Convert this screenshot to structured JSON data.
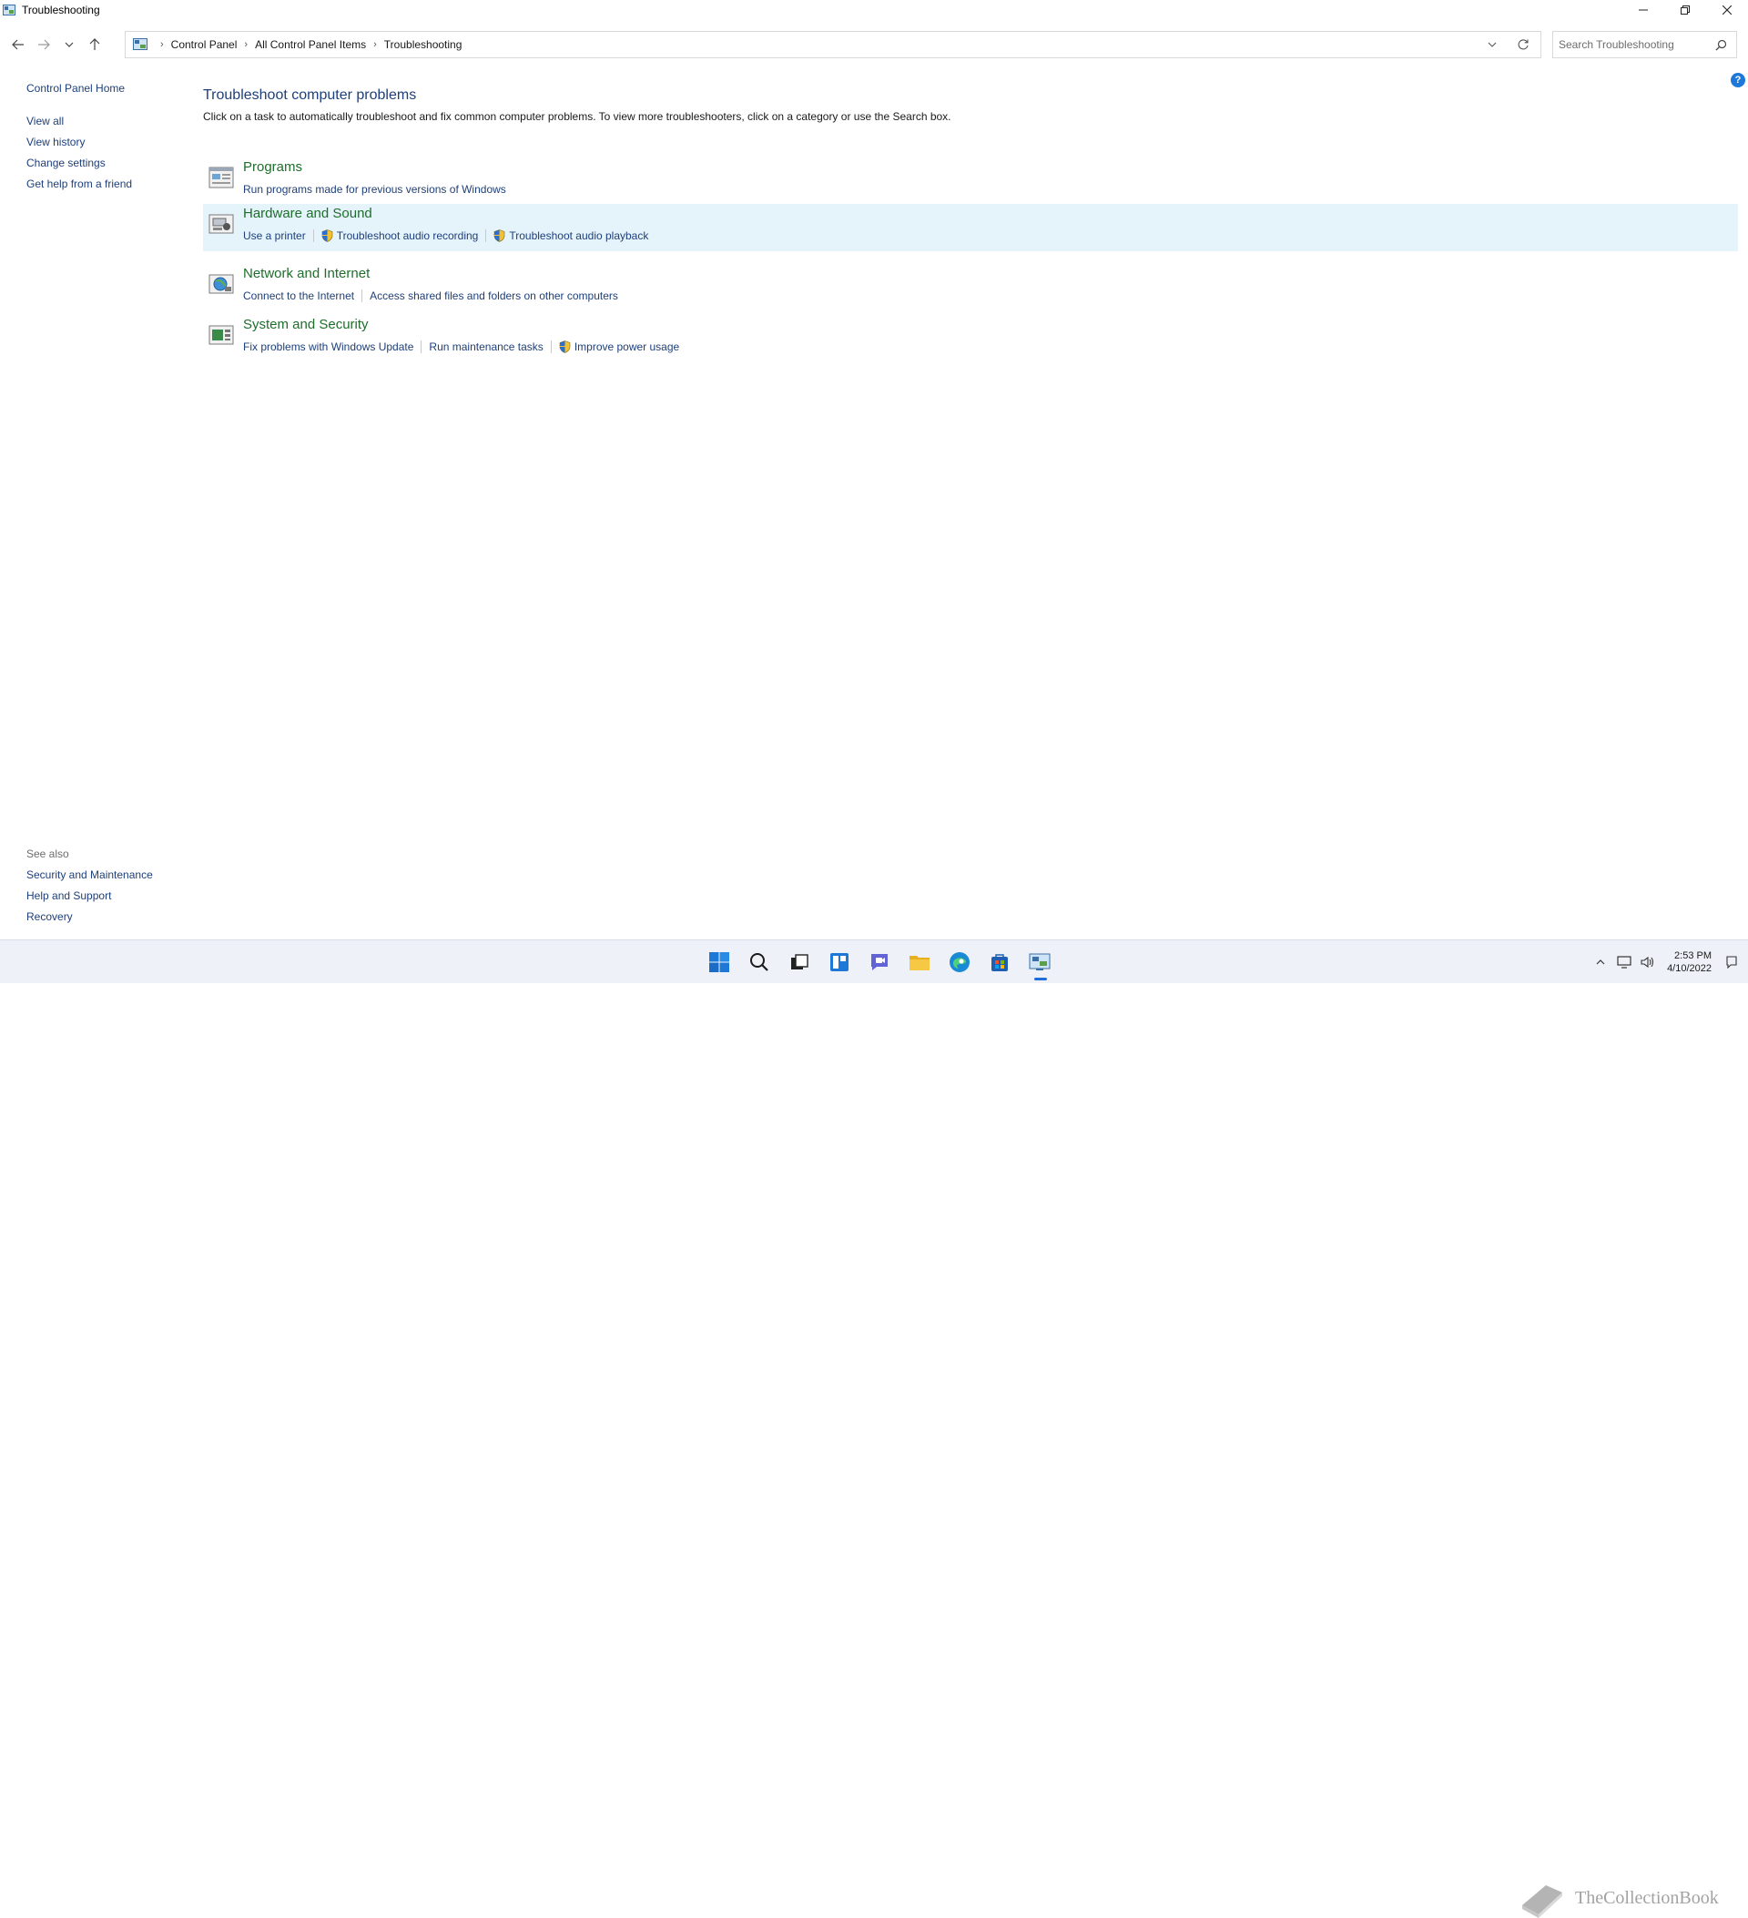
{
  "window": {
    "title": "Troubleshooting"
  },
  "breadcrumb": [
    "Control Panel",
    "All Control Panel Items",
    "Troubleshooting"
  ],
  "search": {
    "placeholder": "Search Troubleshooting"
  },
  "left_nav": {
    "home": "Control Panel Home",
    "items": [
      "View all",
      "View history",
      "Change settings",
      "Get help from a friend"
    ]
  },
  "see_also": {
    "heading": "See also",
    "items": [
      "Security and Maintenance",
      "Help and Support",
      "Recovery"
    ]
  },
  "main": {
    "title": "Troubleshoot computer problems",
    "description": "Click on a task to automatically troubleshoot and fix common computer problems. To view more troubleshooters, click on a category or use the Search box.",
    "categories": [
      {
        "title": "Programs",
        "links": [
          {
            "label": "Run programs made for previous versions of Windows",
            "shield": false
          }
        ]
      },
      {
        "title": "Hardware and Sound",
        "links": [
          {
            "label": "Use a printer",
            "shield": false
          },
          {
            "label": "Troubleshoot audio recording",
            "shield": true
          },
          {
            "label": "Troubleshoot audio playback",
            "shield": true
          }
        ]
      },
      {
        "title": "Network and Internet",
        "links": [
          {
            "label": "Connect to the Internet",
            "shield": false
          },
          {
            "label": "Access shared files and folders on other computers",
            "shield": false
          }
        ]
      },
      {
        "title": "System and Security",
        "links": [
          {
            "label": "Fix problems with Windows Update",
            "shield": false
          },
          {
            "label": "Run maintenance tasks",
            "shield": false
          },
          {
            "label": "Improve power usage",
            "shield": true
          }
        ]
      }
    ]
  },
  "taskbar": {
    "apps": [
      "start-icon",
      "search-icon",
      "task-view-icon",
      "widgets-icon",
      "chat-icon",
      "file-explorer-icon",
      "edge-icon",
      "store-icon",
      "control-panel-icon"
    ],
    "clock": {
      "time": "2:53 PM",
      "date": "4/10/2022"
    }
  },
  "watermark": {
    "text": "TheCollectionBook"
  },
  "colors": {
    "link": "#1e3f7a",
    "category_title": "#1e6e2b",
    "hover_row": "#e5f3fb",
    "taskbar": "#eef2f8"
  }
}
